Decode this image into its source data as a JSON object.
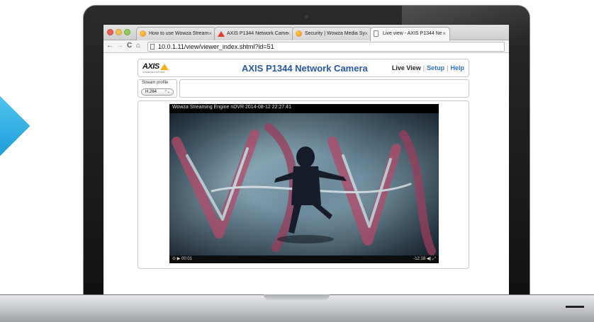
{
  "browser": {
    "tabs": [
      {
        "label": "How to use Wowza Stream",
        "icon": "wowza-icon"
      },
      {
        "label": "AXIS P1344 Network Came",
        "icon": "axis-icon"
      },
      {
        "label": "Security | Wowza Media Sy",
        "icon": "wowza-icon"
      },
      {
        "label": "Live view - AXIS P1344 Ne",
        "icon": "page-icon",
        "active": true
      }
    ],
    "tab_close": "×",
    "nav": {
      "back": "←",
      "forward": "→",
      "reload": "C",
      "home": "⌂"
    },
    "url": "10.0.1.11/view/viewer_index.shtml?id=51"
  },
  "axis_page": {
    "logo_text": "AXIS",
    "logo_sub": "COMMUNICATIONS",
    "title": "AXIS P1344 Network Camera",
    "nav": {
      "live_view": "Live View",
      "sep": "|",
      "setup": "Setup",
      "help": "Help"
    },
    "stream_profile": {
      "label": "Stream profile",
      "value": "H.264",
      "arrow": "⌃⌄"
    },
    "video": {
      "overlay_text": "Wowza Streaming Engine nDVR 2014-08-12 22:27:41",
      "elapsed": "00:01",
      "remaining": "-12:18",
      "play_glyph": "▶",
      "left_glyphs": "⊝",
      "right_glyphs": "◀) ⤢"
    }
  },
  "colors": {
    "axis_title": "#2857a4",
    "link": "#2f6fcf",
    "accent_arrow": "#1e9fd8"
  }
}
